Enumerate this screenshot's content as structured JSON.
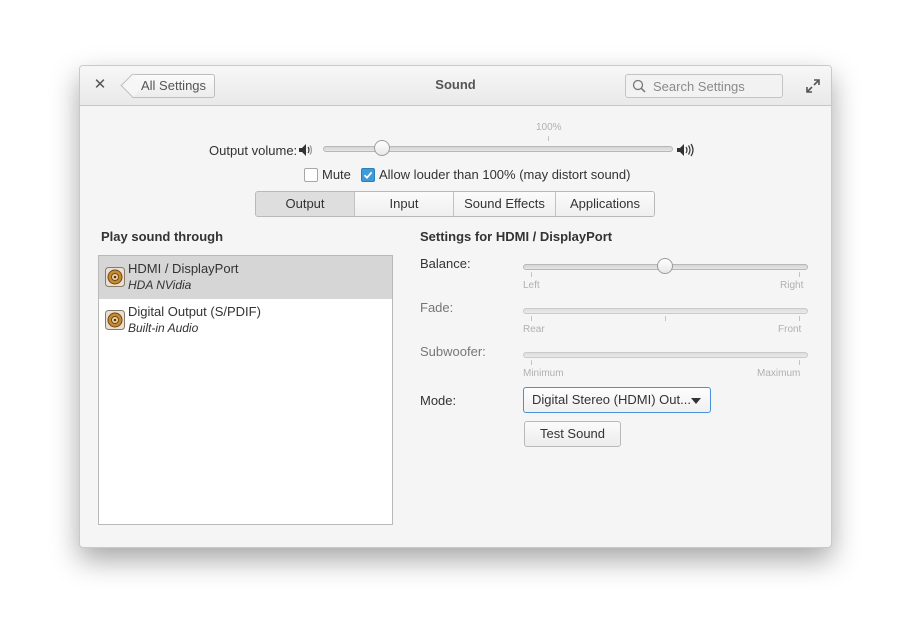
{
  "window": {
    "title": "Sound",
    "back_label": "All Settings",
    "search_placeholder": "Search Settings"
  },
  "output_volume": {
    "label": "Output volume:",
    "mark_label": "100%",
    "level_percent": 17
  },
  "mute": {
    "label": "Mute",
    "checked": false
  },
  "allow_louder": {
    "label": "Allow louder than 100% (may distort sound)",
    "checked": true
  },
  "tabs": [
    {
      "label": "Output",
      "selected": true
    },
    {
      "label": "Input",
      "selected": false
    },
    {
      "label": "Sound Effects",
      "selected": false
    },
    {
      "label": "Applications",
      "selected": false
    }
  ],
  "devices": {
    "heading": "Play sound through",
    "items": [
      {
        "name": "HDMI / DisplayPort",
        "description": "HDA NVidia",
        "selected": true
      },
      {
        "name": "Digital Output (S/PDIF)",
        "description": "Built-in Audio",
        "selected": false
      }
    ]
  },
  "settings": {
    "heading": "Settings for HDMI / DisplayPort",
    "balance": {
      "label": "Balance:",
      "left": "Left",
      "right": "Right",
      "value": 0.5
    },
    "fade": {
      "label": "Fade:",
      "left": "Rear",
      "right": "Front"
    },
    "subwoofer": {
      "label": "Subwoofer:",
      "left": "Minimum",
      "right": "Maximum"
    },
    "mode": {
      "label": "Mode:",
      "value": "Digital Stereo (HDMI) Out..."
    },
    "test_button": "Test Sound"
  },
  "colors": {
    "accent": "#3d9bda",
    "selection": "#d6d6d6"
  }
}
